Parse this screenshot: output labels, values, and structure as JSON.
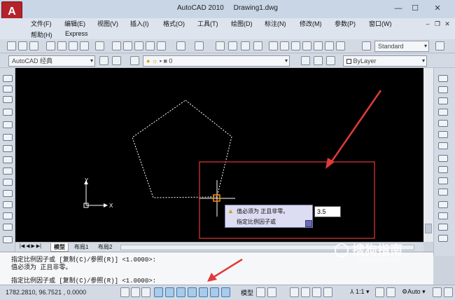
{
  "window": {
    "title": "AutoCAD 2010",
    "document": "Drawing1.dwg",
    "controls": [
      "—",
      "☐",
      "✕"
    ]
  },
  "menu": {
    "row1": [
      "文件(F)",
      "编辑(E)",
      "视图(V)",
      "插入(I)",
      "格式(O)",
      "工具(T)",
      "绘图(D)",
      "标注(N)",
      "修改(M)",
      "参数(P)",
      "窗口(W)"
    ],
    "row2": [
      "帮助(H)",
      "Express"
    ]
  },
  "toolbar": {
    "workspace": "AutoCAD 经典",
    "text_style": "Standard",
    "layer": "0",
    "bylayer": "ByLayer"
  },
  "tabs": [
    "模型",
    "布局1",
    "布局2"
  ],
  "command": {
    "line1": "指定比例因子或 [复制(C)/参照(R)] <1.0000>:",
    "line2": "值必须为 正且非零。",
    "line3": "指定比例因子或 [复制(C)/参照(R)] <1.0000>:"
  },
  "tooltip": {
    "line1": "值必须为 正且非零。",
    "line2": "指定比例因子或",
    "input_value": "3.5"
  },
  "ucs": {
    "x_label": "X",
    "y_label": "Y"
  },
  "status": {
    "coordinates": "1782.2810, 96.7521  , 0.0000",
    "model_label": "模型",
    "scale": "1:1",
    "auto": "Auto"
  },
  "watermark": {
    "text": "搜狗指南",
    "sub": "zhinan.sogou.com"
  },
  "colors": {
    "canvas": "#000000",
    "annotation": "#e03a3a",
    "app_red": "#b4232a"
  }
}
